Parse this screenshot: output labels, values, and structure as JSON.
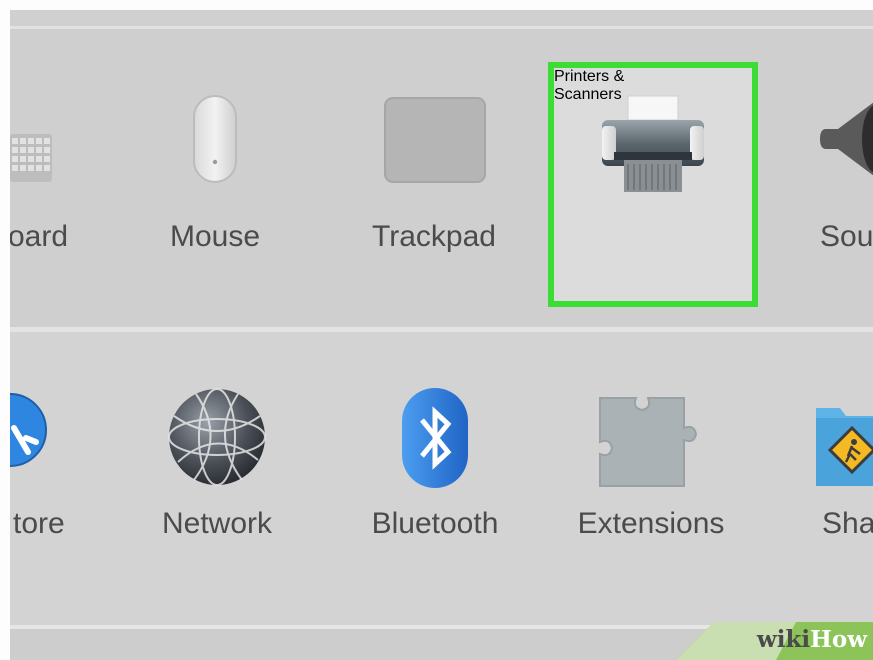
{
  "top_row": {
    "items": [
      {
        "label": "oard",
        "icon": "keyboard-icon"
      },
      {
        "label": "Mouse",
        "icon": "mouse-icon"
      },
      {
        "label": "Trackpad",
        "icon": "trackpad-icon"
      },
      {
        "label_line1": "Printers &",
        "label_line2": "Scanners",
        "icon": "printer-icon",
        "highlighted": true
      },
      {
        "label": "Sou",
        "icon": "speaker-icon"
      }
    ]
  },
  "bottom_row": {
    "items": [
      {
        "label": "tore",
        "icon": "app-store-icon"
      },
      {
        "label": "Network",
        "icon": "network-globe-icon"
      },
      {
        "label": "Bluetooth",
        "icon": "bluetooth-icon"
      },
      {
        "label": "Extensions",
        "icon": "puzzle-piece-icon"
      },
      {
        "label": "Shar",
        "icon": "sharing-folder-icon"
      }
    ]
  },
  "watermark": {
    "part1": "wiki",
    "part2": "How"
  },
  "colors": {
    "highlight": "#3bdc33",
    "bluetooth": "#2f7fd8",
    "watermark_green": "#8cc45a"
  }
}
